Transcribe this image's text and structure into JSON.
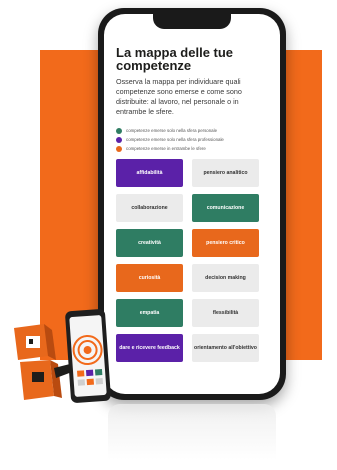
{
  "colors": {
    "background_accent": "#f26a1b",
    "personal": "#2f7d63",
    "professional": "#5b21a8",
    "both": "#e8681c",
    "neutral": "#ebebeb"
  },
  "screen": {
    "title": "La mappa delle tue competenze",
    "subtitle": "Osserva la mappa per individuare quali competenze sono emerse e come sono distribuite: al lavoro, nel personale o in entrambe le sfere."
  },
  "legend": [
    {
      "label": "competenze emerse solo nella sfera personale",
      "color": "#2f7d63"
    },
    {
      "label": "competenze emerse solo nella sfera professionale",
      "color": "#5b21a8"
    },
    {
      "label": "competenze emerse in entrambe le sfere",
      "color": "#e8681c"
    }
  ],
  "tiles": [
    {
      "label": "affidabilità",
      "kind": "professional"
    },
    {
      "label": "pensiero analitico",
      "kind": "neutral"
    },
    {
      "label": "collaborazione",
      "kind": "neutral"
    },
    {
      "label": "comunicazione",
      "kind": "personal"
    },
    {
      "label": "creatività",
      "kind": "personal"
    },
    {
      "label": "pensiero critico",
      "kind": "both"
    },
    {
      "label": "curiosità",
      "kind": "both"
    },
    {
      "label": "decision making",
      "kind": "neutral"
    },
    {
      "label": "empatia",
      "kind": "personal"
    },
    {
      "label": "flessibilità",
      "kind": "neutral"
    },
    {
      "label": "dare e ricevere feedback",
      "kind": "professional"
    },
    {
      "label": "orientamento all'obiettivo",
      "kind": "neutral"
    }
  ]
}
